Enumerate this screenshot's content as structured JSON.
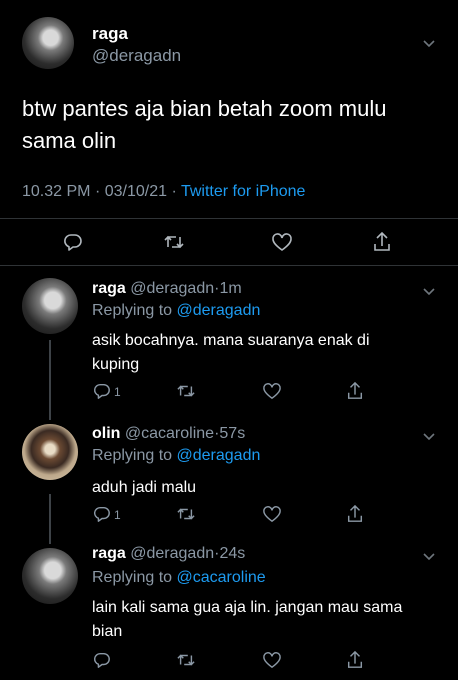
{
  "main_tweet": {
    "display_name": "raga",
    "handle": "@deragadn",
    "text_line1": "btw pantes aja bian betah zoom mulu",
    "text_line2": "sama olin",
    "time": "10.32 PM",
    "date": "03/10/21",
    "separator": "·",
    "source": "Twitter for iPhone"
  },
  "replies": [
    {
      "display_name": "raga",
      "handle": "@deragadn",
      "age": "1m",
      "replying_to_prefix": "Replying to",
      "replying_to": "@deragadn",
      "text_line1": "asik bocahnya. mana suaranya enak di",
      "text_line2": "kuping",
      "reply_count": "1"
    },
    {
      "display_name": "olin",
      "handle": "@cacaroline",
      "age": "57s",
      "replying_to_prefix": "Replying to",
      "replying_to": "@deragadn",
      "text_line1": "aduh jadi malu",
      "reply_count": "1"
    },
    {
      "display_name": "raga",
      "handle": "@deragadn",
      "age": "24s",
      "replying_to_prefix": "Replying to",
      "replying_to": "@cacaroline",
      "text_line1": "lain kali sama gua aja lin. jangan mau sama",
      "text_line2": "bian"
    }
  ],
  "icons": [
    "reply-icon",
    "retweet-icon",
    "like-icon",
    "share-icon",
    "chevron-down-icon"
  ],
  "colors": {
    "background": "#000000",
    "text": "#ffffff",
    "muted": "#8b98a5",
    "link": "#1d9bf0",
    "divider": "#2f3336"
  }
}
